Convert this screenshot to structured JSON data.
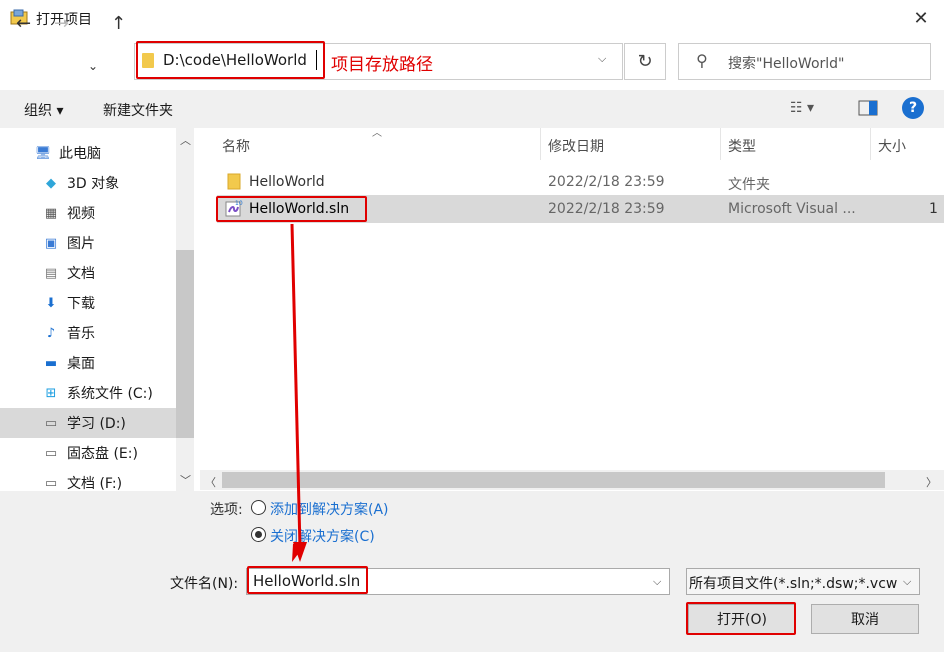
{
  "window": {
    "title": "打开项目"
  },
  "address": {
    "path": "D:\\code\\HelloWorld",
    "annotation": "项目存放路径"
  },
  "search": {
    "placeholder": "搜索\"HelloWorld\""
  },
  "toolbar": {
    "organize": "组织 ▾",
    "new_folder": "新建文件夹"
  },
  "sidebar": {
    "items": [
      {
        "label": "此电脑",
        "icon": "computer-icon"
      },
      {
        "label": "3D 对象",
        "icon": "cube-icon"
      },
      {
        "label": "视频",
        "icon": "video-icon"
      },
      {
        "label": "图片",
        "icon": "picture-icon"
      },
      {
        "label": "文档",
        "icon": "document-icon"
      },
      {
        "label": "下载",
        "icon": "download-icon"
      },
      {
        "label": "音乐",
        "icon": "music-icon"
      },
      {
        "label": "桌面",
        "icon": "desktop-icon"
      },
      {
        "label": "系统文件 (C:)",
        "icon": "windows-drive-icon"
      },
      {
        "label": "学习 (D:)",
        "icon": "drive-icon"
      },
      {
        "label": "固态盘 (E:)",
        "icon": "drive-icon"
      },
      {
        "label": "文档 (F:)",
        "icon": "drive-icon"
      }
    ],
    "selected_index": 9
  },
  "columns": {
    "name": "名称",
    "date": "修改日期",
    "type": "类型",
    "size": "大小"
  },
  "files": [
    {
      "name": "HelloWorld",
      "date": "2022/2/18 23:59",
      "type": "文件夹",
      "size": "",
      "icon": "folder-icon"
    },
    {
      "name": "HelloWorld.sln",
      "date": "2022/2/18 23:59",
      "type": "Microsoft Visual ...",
      "size": "1",
      "icon": "vs-solution-icon"
    }
  ],
  "options": {
    "label": "选项:",
    "add_to_solution": "添加到解决方案(A)",
    "close_solution": "关闭解决方案(C)",
    "selected": "close_solution"
  },
  "filename": {
    "label": "文件名(N):",
    "value": "HelloWorld.sln"
  },
  "filetype": {
    "value": "所有项目文件(*.sln;*.dsw;*.vcw"
  },
  "buttons": {
    "open": "打开(O)",
    "cancel": "取消"
  },
  "colors": {
    "highlight": "#e00000",
    "link": "#1a6fd0",
    "selected_bg": "#d9d9d9"
  }
}
